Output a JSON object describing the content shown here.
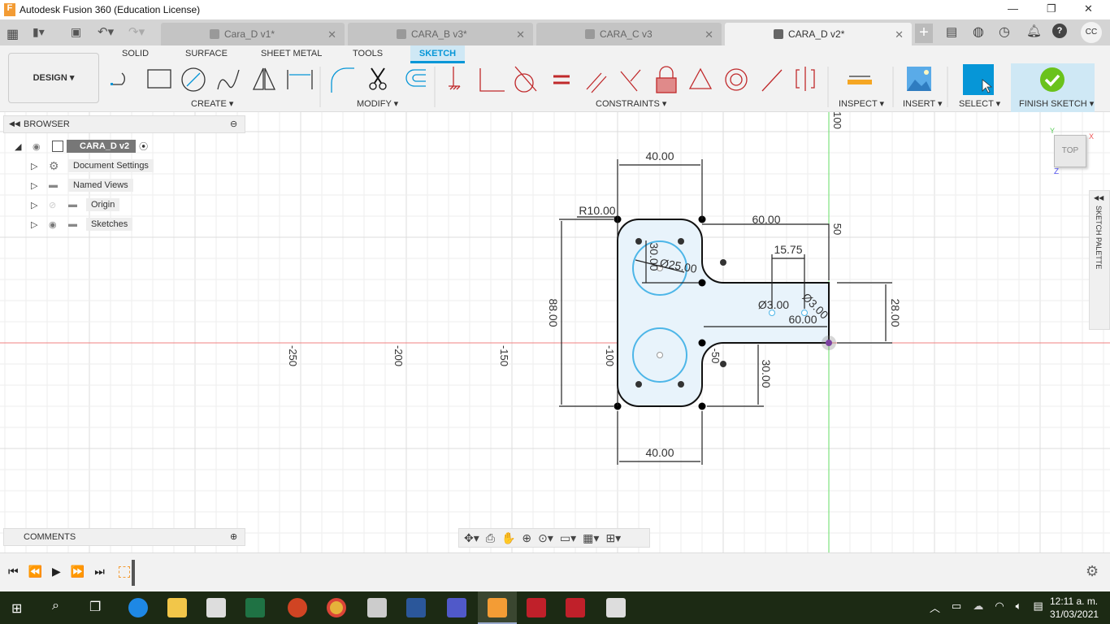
{
  "window": {
    "title": "Autodesk Fusion 360 (Education License)",
    "controls": [
      "—",
      "❐",
      "✕"
    ]
  },
  "tabs": [
    {
      "label": "Cara_D v1*",
      "active": false
    },
    {
      "label": "CARA_B v3*",
      "active": false
    },
    {
      "label": "CARA_C v3",
      "active": false
    },
    {
      "label": "CARA_D v2*",
      "active": true
    }
  ],
  "user": {
    "initials": "CC"
  },
  "ribbon": {
    "workspace": "DESIGN ▾",
    "tabs": [
      "SOLID",
      "SURFACE",
      "SHEET METAL",
      "TOOLS",
      "SKETCH"
    ],
    "active_tab": "SKETCH",
    "groups": {
      "create": "CREATE ▾",
      "modify": "MODIFY ▾",
      "constraints": "CONSTRAINTS ▾",
      "inspect": "INSPECT ▾",
      "insert": "INSERT ▾",
      "select": "SELECT ▾",
      "finish": "FINISH SKETCH ▾"
    }
  },
  "browser": {
    "title": "BROWSER",
    "root": "CARA_D v2",
    "items": [
      "Document Settings",
      "Named Views",
      "Origin",
      "Sketches"
    ]
  },
  "comments": {
    "title": "COMMENTS"
  },
  "sketch_palette": {
    "title": "SKETCH PALETTE"
  },
  "viewcube": {
    "face": "TOP",
    "axes": {
      "x": "X",
      "y": "Y",
      "z": "Z"
    }
  },
  "axis_labels": {
    "x": [
      "-250",
      "-200",
      "-150",
      "-100",
      "-50"
    ],
    "y": [
      "100",
      "50"
    ]
  },
  "dimensions": {
    "top_width": "40.00",
    "radius": "R10.00",
    "arm_length": "60.00",
    "hole_spacing": "15.75",
    "hole_offset": "30.00",
    "big_hole": "Ø25.00",
    "small_hole_1": "Ø3.00",
    "small_hole_2": "Ø3.00",
    "arm_inner": "60.00",
    "arm_height": "28.00",
    "total_height": "88.00",
    "bottom_offset": "30.00",
    "bottom_width": "40.00"
  },
  "colors": {
    "accent": "#0696d7",
    "sketch_fill": "#e8f3fb",
    "circle": "#4db6e8",
    "x_axis": "#f08080",
    "y_axis": "#66dd66",
    "finish": "#6ac21b"
  },
  "taskbar": {
    "time": "12:11 a. m.",
    "date": "31/03/2021"
  }
}
